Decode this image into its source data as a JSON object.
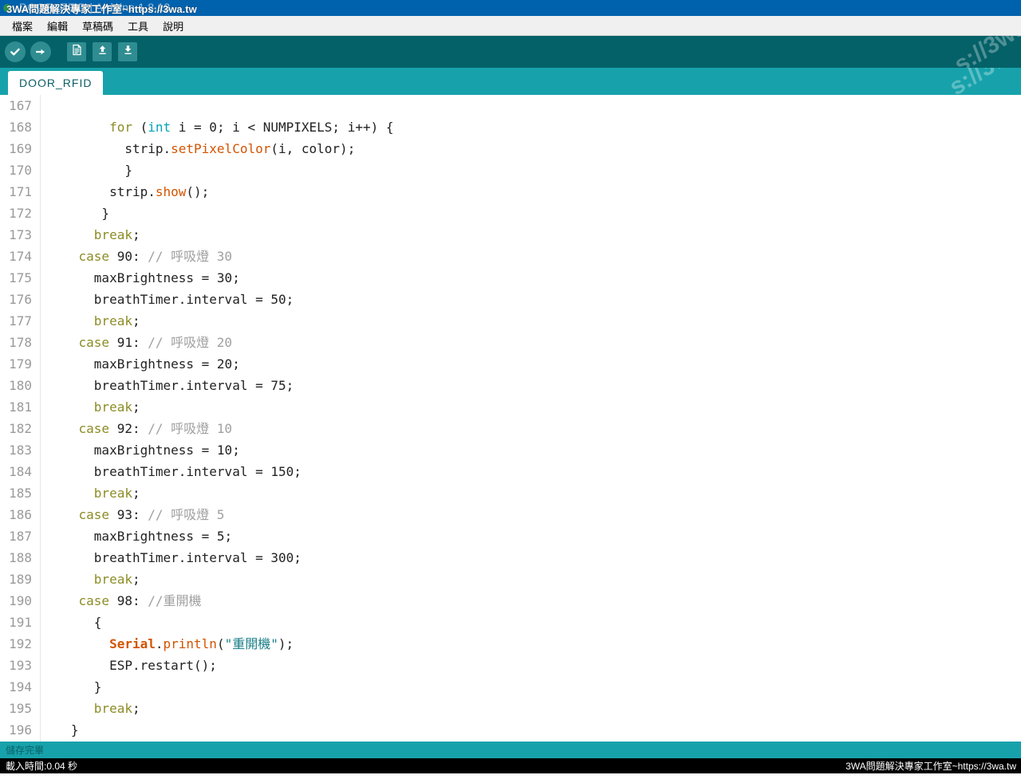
{
  "window": {
    "title": "DOOR_RFID | Arduino 1.8.13",
    "watermark": "3WA問題解決專家工作室~https://3wa.tw"
  },
  "menubar": {
    "items": [
      {
        "label": "檔案"
      },
      {
        "label": "編輯"
      },
      {
        "label": "草稿碼"
      },
      {
        "label": "工具"
      },
      {
        "label": "說明"
      }
    ]
  },
  "toolbar": {
    "verify_label": "驗證",
    "upload_label": "上傳",
    "new_label": "新增",
    "open_label": "開啟",
    "save_label": "儲存",
    "bg_color": "#046168",
    "button_color": "#2f8d91"
  },
  "tabs": [
    {
      "label": "DOOR_RFID",
      "active": true
    }
  ],
  "editor": {
    "first_line": 167,
    "colors": {
      "keyword": "#8c8c26",
      "type": "#00a3b4",
      "function": "#d35400",
      "string": "#1a7f87",
      "comment": "#a0a0a0",
      "linenumber": "#9a9a9a"
    },
    "lines": [
      {
        "n": "167",
        "html": ""
      },
      {
        "n": "168",
        "html": "        <span class='k-kw'>for</span> (<span class='k-type'>int</span> i = 0; i &lt; NUMPIXELS; i++) {"
      },
      {
        "n": "169",
        "html": "          strip.<span class='k-fn'>setPixelColor</span>(i, color);"
      },
      {
        "n": "170",
        "html": "          }"
      },
      {
        "n": "171",
        "html": "        strip.<span class='k-fn'>show</span>();"
      },
      {
        "n": "172",
        "html": "       }"
      },
      {
        "n": "173",
        "html": "      <span class='k-kw'>break</span>;"
      },
      {
        "n": "174",
        "html": "    <span class='k-kw'>case</span> 90: <span class='k-com'>// 呼吸燈 30</span>"
      },
      {
        "n": "175",
        "html": "      maxBrightness = 30;"
      },
      {
        "n": "176",
        "html": "      breathTimer.interval = 50;"
      },
      {
        "n": "177",
        "html": "      <span class='k-kw'>break</span>;"
      },
      {
        "n": "178",
        "html": "    <span class='k-kw'>case</span> 91: <span class='k-com'>// 呼吸燈 20</span>"
      },
      {
        "n": "179",
        "html": "      maxBrightness = 20;"
      },
      {
        "n": "180",
        "html": "      breathTimer.interval = 75;"
      },
      {
        "n": "181",
        "html": "      <span class='k-kw'>break</span>;"
      },
      {
        "n": "182",
        "html": "    <span class='k-kw'>case</span> 92: <span class='k-com'>// 呼吸燈 10</span>"
      },
      {
        "n": "183",
        "html": "      maxBrightness = 10;"
      },
      {
        "n": "184",
        "html": "      breathTimer.interval = 150;"
      },
      {
        "n": "185",
        "html": "      <span class='k-kw'>break</span>;"
      },
      {
        "n": "186",
        "html": "    <span class='k-kw'>case</span> 93: <span class='k-com'>// 呼吸燈 5</span>"
      },
      {
        "n": "187",
        "html": "      maxBrightness = 5;"
      },
      {
        "n": "188",
        "html": "      breathTimer.interval = 300;"
      },
      {
        "n": "189",
        "html": "      <span class='k-kw'>break</span>;"
      },
      {
        "n": "190",
        "html": "    <span class='k-kw'>case</span> 98: <span class='k-com'>//重開機</span>"
      },
      {
        "n": "191",
        "html": "      {"
      },
      {
        "n": "192",
        "html": "        <span class='k-obj'>Serial</span>.<span class='k-fn'>println</span>(<span class='k-str'>\"重開機\"</span>);"
      },
      {
        "n": "193",
        "html": "        ESP.restart();"
      },
      {
        "n": "194",
        "html": "      }"
      },
      {
        "n": "195",
        "html": "      <span class='k-kw'>break</span>;"
      },
      {
        "n": "196",
        "html": "   }"
      }
    ]
  },
  "statusbar": {
    "message": "儲存完畢",
    "bg_color": "#17a2ab"
  },
  "console": {
    "message": "載入時間:0.04 秒",
    "watermark": "3WA問題解決專家工作室~https://3wa.tw",
    "bg_color": "#000000"
  }
}
